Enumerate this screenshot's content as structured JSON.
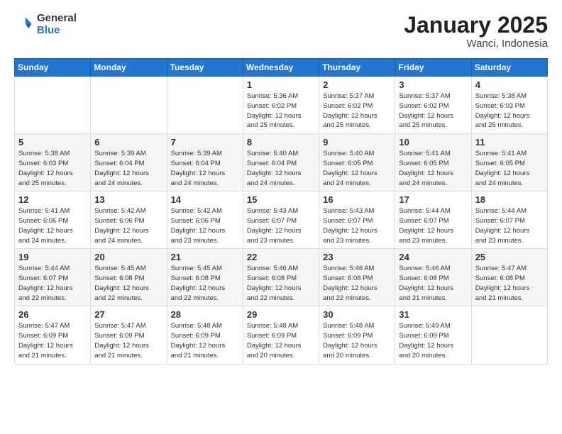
{
  "header": {
    "logo_general": "General",
    "logo_blue": "Blue",
    "title": "January 2025",
    "subtitle": "Wanci, Indonesia"
  },
  "weekdays": [
    "Sunday",
    "Monday",
    "Tuesday",
    "Wednesday",
    "Thursday",
    "Friday",
    "Saturday"
  ],
  "weeks": [
    [
      {
        "day": "",
        "info": ""
      },
      {
        "day": "",
        "info": ""
      },
      {
        "day": "",
        "info": ""
      },
      {
        "day": "1",
        "info": "Sunrise: 5:36 AM\nSunset: 6:02 PM\nDaylight: 12 hours\nand 25 minutes."
      },
      {
        "day": "2",
        "info": "Sunrise: 5:37 AM\nSunset: 6:02 PM\nDaylight: 12 hours\nand 25 minutes."
      },
      {
        "day": "3",
        "info": "Sunrise: 5:37 AM\nSunset: 6:02 PM\nDaylight: 12 hours\nand 25 minutes."
      },
      {
        "day": "4",
        "info": "Sunrise: 5:38 AM\nSunset: 6:03 PM\nDaylight: 12 hours\nand 25 minutes."
      }
    ],
    [
      {
        "day": "5",
        "info": "Sunrise: 5:38 AM\nSunset: 6:03 PM\nDaylight: 12 hours\nand 25 minutes."
      },
      {
        "day": "6",
        "info": "Sunrise: 5:39 AM\nSunset: 6:04 PM\nDaylight: 12 hours\nand 24 minutes."
      },
      {
        "day": "7",
        "info": "Sunrise: 5:39 AM\nSunset: 6:04 PM\nDaylight: 12 hours\nand 24 minutes."
      },
      {
        "day": "8",
        "info": "Sunrise: 5:40 AM\nSunset: 6:04 PM\nDaylight: 12 hours\nand 24 minutes."
      },
      {
        "day": "9",
        "info": "Sunrise: 5:40 AM\nSunset: 6:05 PM\nDaylight: 12 hours\nand 24 minutes."
      },
      {
        "day": "10",
        "info": "Sunrise: 5:41 AM\nSunset: 6:05 PM\nDaylight: 12 hours\nand 24 minutes."
      },
      {
        "day": "11",
        "info": "Sunrise: 5:41 AM\nSunset: 6:05 PM\nDaylight: 12 hours\nand 24 minutes."
      }
    ],
    [
      {
        "day": "12",
        "info": "Sunrise: 5:41 AM\nSunset: 6:06 PM\nDaylight: 12 hours\nand 24 minutes."
      },
      {
        "day": "13",
        "info": "Sunrise: 5:42 AM\nSunset: 6:06 PM\nDaylight: 12 hours\nand 24 minutes."
      },
      {
        "day": "14",
        "info": "Sunrise: 5:42 AM\nSunset: 6:06 PM\nDaylight: 12 hours\nand 23 minutes."
      },
      {
        "day": "15",
        "info": "Sunrise: 5:43 AM\nSunset: 6:07 PM\nDaylight: 12 hours\nand 23 minutes."
      },
      {
        "day": "16",
        "info": "Sunrise: 5:43 AM\nSunset: 6:07 PM\nDaylight: 12 hours\nand 23 minutes."
      },
      {
        "day": "17",
        "info": "Sunrise: 5:44 AM\nSunset: 6:07 PM\nDaylight: 12 hours\nand 23 minutes."
      },
      {
        "day": "18",
        "info": "Sunrise: 5:44 AM\nSunset: 6:07 PM\nDaylight: 12 hours\nand 23 minutes."
      }
    ],
    [
      {
        "day": "19",
        "info": "Sunrise: 5:44 AM\nSunset: 6:07 PM\nDaylight: 12 hours\nand 22 minutes."
      },
      {
        "day": "20",
        "info": "Sunrise: 5:45 AM\nSunset: 6:08 PM\nDaylight: 12 hours\nand 22 minutes."
      },
      {
        "day": "21",
        "info": "Sunrise: 5:45 AM\nSunset: 6:08 PM\nDaylight: 12 hours\nand 22 minutes."
      },
      {
        "day": "22",
        "info": "Sunrise: 5:46 AM\nSunset: 6:08 PM\nDaylight: 12 hours\nand 22 minutes."
      },
      {
        "day": "23",
        "info": "Sunrise: 5:46 AM\nSunset: 6:08 PM\nDaylight: 12 hours\nand 22 minutes."
      },
      {
        "day": "24",
        "info": "Sunrise: 5:46 AM\nSunset: 6:08 PM\nDaylight: 12 hours\nand 21 minutes."
      },
      {
        "day": "25",
        "info": "Sunrise: 5:47 AM\nSunset: 6:08 PM\nDaylight: 12 hours\nand 21 minutes."
      }
    ],
    [
      {
        "day": "26",
        "info": "Sunrise: 5:47 AM\nSunset: 6:09 PM\nDaylight: 12 hours\nand 21 minutes."
      },
      {
        "day": "27",
        "info": "Sunrise: 5:47 AM\nSunset: 6:09 PM\nDaylight: 12 hours\nand 21 minutes."
      },
      {
        "day": "28",
        "info": "Sunrise: 5:48 AM\nSunset: 6:09 PM\nDaylight: 12 hours\nand 21 minutes."
      },
      {
        "day": "29",
        "info": "Sunrise: 5:48 AM\nSunset: 6:09 PM\nDaylight: 12 hours\nand 20 minutes."
      },
      {
        "day": "30",
        "info": "Sunrise: 5:48 AM\nSunset: 6:09 PM\nDaylight: 12 hours\nand 20 minutes."
      },
      {
        "day": "31",
        "info": "Sunrise: 5:49 AM\nSunset: 6:09 PM\nDaylight: 12 hours\nand 20 minutes."
      },
      {
        "day": "",
        "info": ""
      }
    ]
  ]
}
